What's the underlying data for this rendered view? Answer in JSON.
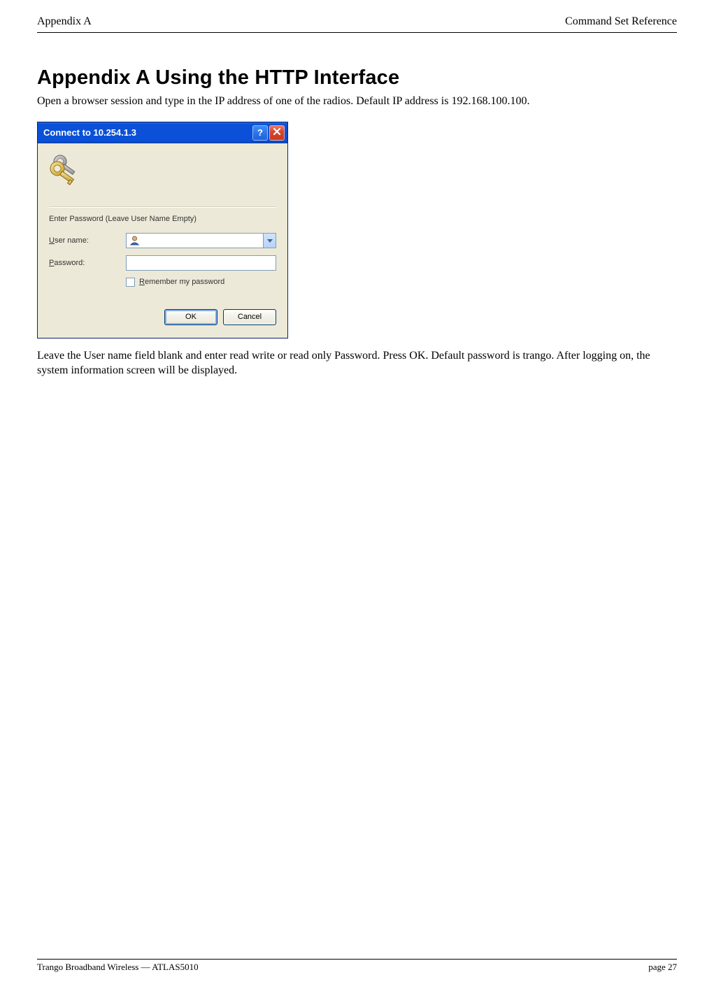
{
  "header": {
    "left": "Appendix A",
    "right": "Command Set Reference"
  },
  "heading": "Appendix A   Using the HTTP Interface",
  "intro": "Open a browser session and type in the IP address of one of the radios.  Default IP address is 192.168.100.100.",
  "dialog": {
    "title": "Connect to 10.254.1.3",
    "help_char": "?",
    "prompt": "Enter Password (Leave User Name Empty)",
    "username_label_pre": "U",
    "username_label_post": "ser name:",
    "username_value": "",
    "password_label_pre": "P",
    "password_label_post": "assword:",
    "password_value": "",
    "remember_pre": "R",
    "remember_post": "emember my password",
    "ok_label": "OK",
    "cancel_label": "Cancel"
  },
  "outro": "Leave the User name field blank and enter read write or read only Password.  Press OK.  Default password is trango.  After logging on, the system information screen will be displayed.",
  "footer": {
    "left": "Trango Broadband Wireless — ATLAS5010",
    "right": "page 27"
  }
}
